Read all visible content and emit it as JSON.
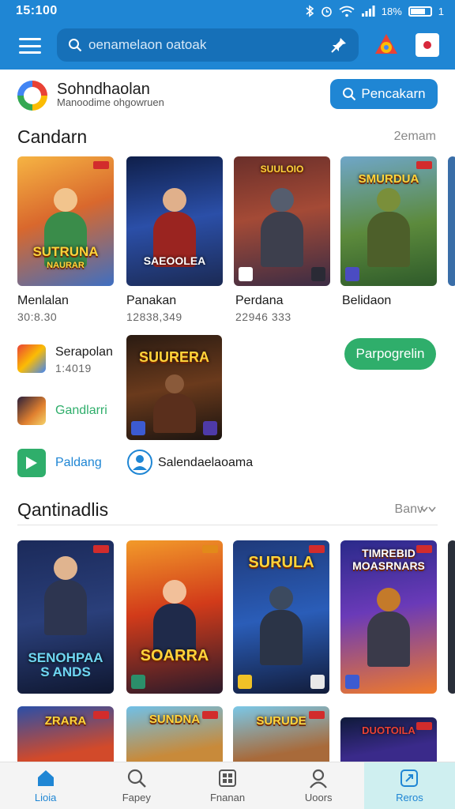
{
  "status_bar": {
    "time": "15:100",
    "battery_text": "18%",
    "battery_level": 0.7,
    "extra": "1"
  },
  "search": {
    "placeholder": "oenamelaon oatoak"
  },
  "profile": {
    "name": "Sohndhaolan",
    "subtitle": "Manoodime ohgowruen",
    "button_label": "Pencakarn"
  },
  "section1": {
    "title": "Candarn",
    "more": "2emam",
    "games": [
      {
        "name": "Menlalan",
        "meta": "30:8.30",
        "art": "SUTRUNA",
        "art2": "NAURAR"
      },
      {
        "name": "Panakan",
        "meta": "12838,349",
        "art": "SAEOOLEA"
      },
      {
        "name": "Perdana",
        "meta": "22946 333",
        "art": "SUULOIO"
      },
      {
        "name": "Belidaon",
        "meta": "",
        "art": "SMURDUA"
      }
    ],
    "list": [
      {
        "label": "Serapolan",
        "meta": "1:4019"
      },
      {
        "label": "Gandlarri"
      },
      {
        "label": "Paldang"
      }
    ],
    "featured_art": "SUURERA",
    "green_button": "Parpogrelin",
    "user_label": "Salendaelaoama"
  },
  "section2": {
    "title": "Qantinadlis",
    "more": "Banv",
    "games": [
      {
        "art": "SENOHPAA",
        "art2": "S ANDS"
      },
      {
        "art": "SOARRA"
      },
      {
        "art": "SURULA"
      },
      {
        "art": "TIMREBID",
        "art2": "MOASRNARS"
      },
      {
        "art": "ZRARA"
      },
      {
        "art": "SUNDNA"
      },
      {
        "art": "SURUDE"
      },
      {
        "art": "DUOTOILA"
      }
    ]
  },
  "bottom_nav": [
    {
      "label": "Lioia"
    },
    {
      "label": "Fapey"
    },
    {
      "label": "Fnanan"
    },
    {
      "label": "Uoors"
    },
    {
      "label": "Reros"
    }
  ],
  "colors": {
    "brand": "#1f86d4",
    "accent_green": "#2fae6b",
    "badge_red": "#d22c2c"
  }
}
